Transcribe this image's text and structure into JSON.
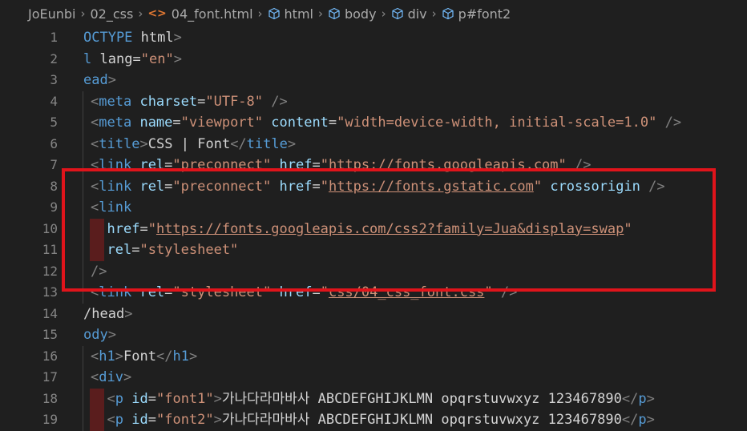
{
  "breadcrumb": {
    "items": [
      {
        "label": "JoEunbi",
        "icon": ""
      },
      {
        "label": "02_css",
        "icon": ""
      },
      {
        "label": "04_font.html",
        "icon": "html-file-icon"
      },
      {
        "label": "html",
        "icon": "cube-icon"
      },
      {
        "label": "body",
        "icon": "cube-icon"
      },
      {
        "label": "div",
        "icon": "cube-icon"
      },
      {
        "label": "p#font2",
        "icon": "cube-icon"
      }
    ]
  },
  "editor": {
    "line_numbers": [
      "1",
      "2",
      "3",
      "4",
      "5",
      "6",
      "7",
      "8",
      "9",
      "10",
      "11",
      "12",
      "13",
      "14",
      "15",
      "16",
      "17",
      "18",
      "19"
    ],
    "lines": [
      "OCTYPE html>",
      "l lang=\"en\">",
      "ead>",
      "<meta charset=\"UTF-8\" />",
      "<meta name=\"viewport\" content=\"width=device-width, initial-scale=1.0\" />",
      "<title>CSS | Font</title>",
      "<link rel=\"preconnect\" href=\"https://fonts.googleapis.com\" />",
      "<link rel=\"preconnect\" href=\"https://fonts.gstatic.com\" crossorigin />",
      "<link",
      "  href=\"https://fonts.googleapis.com/css2?family=Jua&display=swap\"",
      "  rel=\"stylesheet\"",
      "/>",
      "<link rel=\"stylesheet\" href=\"css/04_css_font.css\" />",
      "/head>",
      "ody>",
      "<h1>Font</h1>",
      "<div>",
      "  <p id=\"font1\">가나다라마바사 ABCDEFGHIJKLMN opqrstuvwxyz 123467890</p>",
      "  <p id=\"font2\">가나다라마바사 ABCDEFGHIJKLMN opqrstuvwxyz 123467890</p>"
    ]
  },
  "colors": {
    "background": "#1f1f1f",
    "tag": "#569cd6",
    "attribute": "#9cdcfe",
    "string": "#ce9178",
    "highlight_box": "#e0141b"
  }
}
